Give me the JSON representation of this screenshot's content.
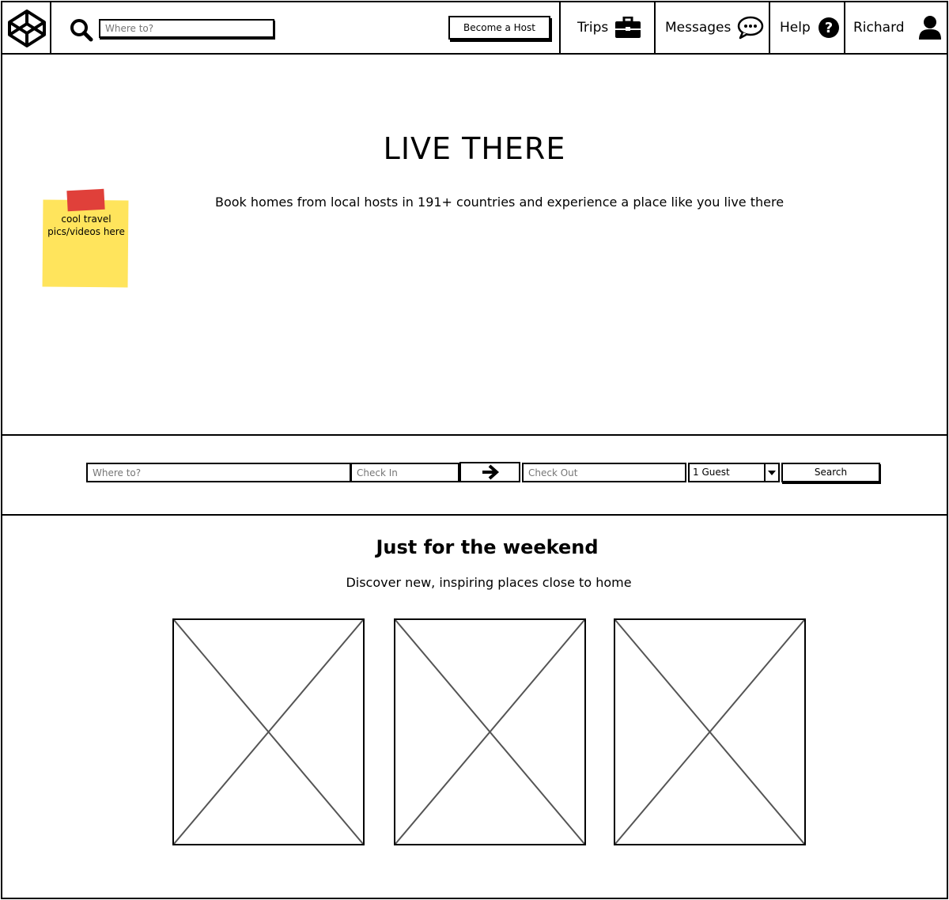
{
  "header": {
    "logo_icon": "codepen-cube-icon",
    "search_icon": "search-icon",
    "search_placeholder": "Where to?",
    "become_host_label": "Become a Host",
    "nav": {
      "trips": "Trips",
      "messages": "Messages",
      "help": "Help",
      "user": "Richard"
    },
    "nav_icons": {
      "trips": "briefcase-icon",
      "messages": "chat-bubble-icon",
      "help": "question-circle-icon",
      "user": "user-icon"
    }
  },
  "hero": {
    "title": "LIVE THERE",
    "subtitle": "Book homes from local hosts in 191+ countries and experience a place like you live there",
    "sticky_note": "cool travel pics/videos here"
  },
  "search_bar": {
    "where_placeholder": "Where to?",
    "check_in_placeholder": "Check In",
    "check_out_placeholder": "Check Out",
    "arrow_icon": "arrow-right-icon",
    "guests_selected": "1 Guest",
    "search_label": "Search"
  },
  "weekend": {
    "title": "Just for the weekend",
    "subtitle": "Discover new, inspiring places close to home",
    "cards": [
      {
        "icon": "image-placeholder-icon"
      },
      {
        "icon": "image-placeholder-icon"
      },
      {
        "icon": "image-placeholder-icon"
      }
    ]
  },
  "colors": {
    "sticky_note": "#ffe45c",
    "sticky_tape": "#e0403a",
    "stroke": "#000000",
    "placeholder_cross": "#555555"
  }
}
